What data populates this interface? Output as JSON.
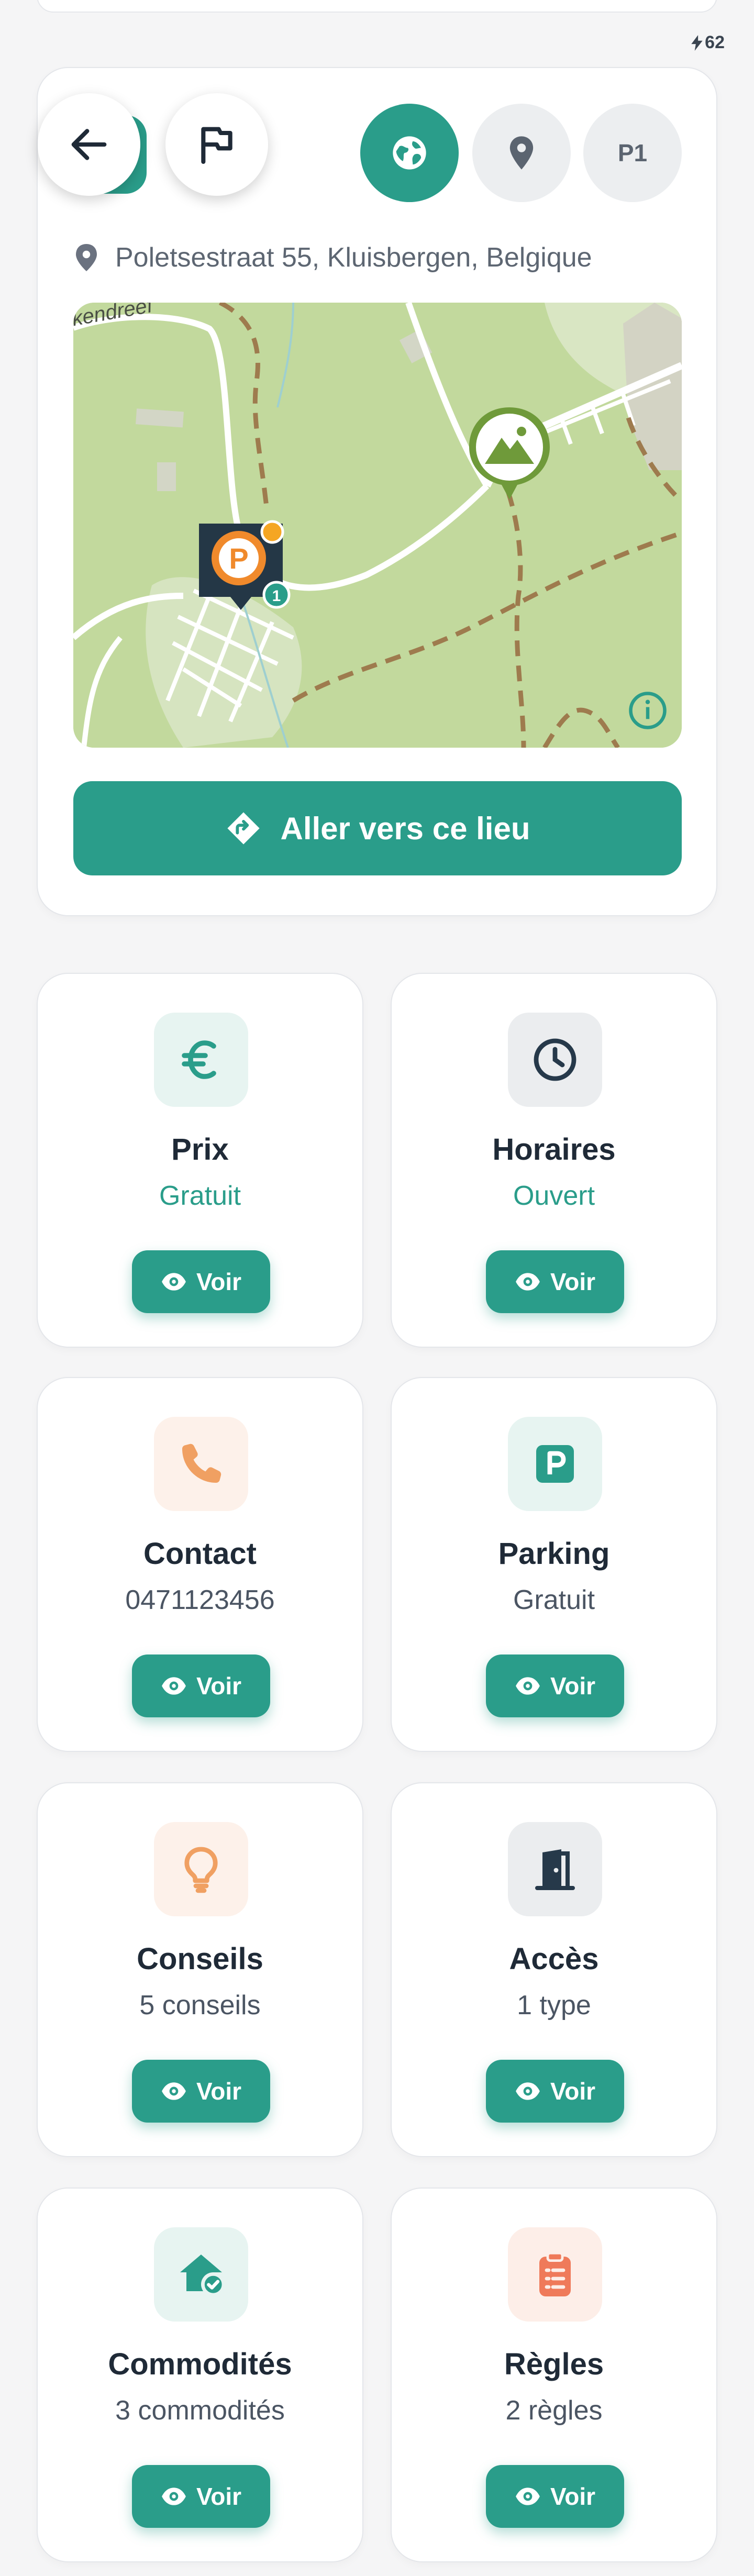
{
  "status": {
    "battery": "62"
  },
  "header": {
    "back_label": "Retour",
    "flag_label": "Signaler",
    "pill_p1": "P1",
    "address": "Poletsestraat 55, Kluisbergen, Belgique"
  },
  "map": {
    "street_label": "kendreef",
    "parking_count": "1",
    "parking_letter": "P"
  },
  "go_button": {
    "label": "Aller vers ce lieu"
  },
  "tiles": [
    {
      "title": "Prix",
      "subtitle": "Gratuit",
      "action": "Voir",
      "icon": "euro-icon"
    },
    {
      "title": "Horaires",
      "subtitle": "Ouvert",
      "action": "Voir",
      "icon": "clock-icon"
    },
    {
      "title": "Contact",
      "subtitle": "0471123456",
      "action": "Voir",
      "icon": "phone-icon"
    },
    {
      "title": "Parking",
      "subtitle": "Gratuit",
      "action": "Voir",
      "icon": "parking-icon"
    },
    {
      "title": "Conseils",
      "subtitle": "5 conseils",
      "action": "Voir",
      "icon": "lightbulb-icon"
    },
    {
      "title": "Accès",
      "subtitle": "1 type",
      "action": "Voir",
      "icon": "door-icon"
    },
    {
      "title": "Commodités",
      "subtitle": "3 commodités",
      "action": "Voir",
      "icon": "home-check-icon"
    },
    {
      "title": "Règles",
      "subtitle": "2 règles",
      "action": "Voir",
      "icon": "clipboard-list-icon"
    }
  ],
  "colors": {
    "accent": "#2a9d8a",
    "text_dark": "#1f2a37",
    "text_muted": "#4b5563",
    "orange": "#f0a062",
    "coral": "#ef7a5a",
    "navy": "#26394a"
  }
}
